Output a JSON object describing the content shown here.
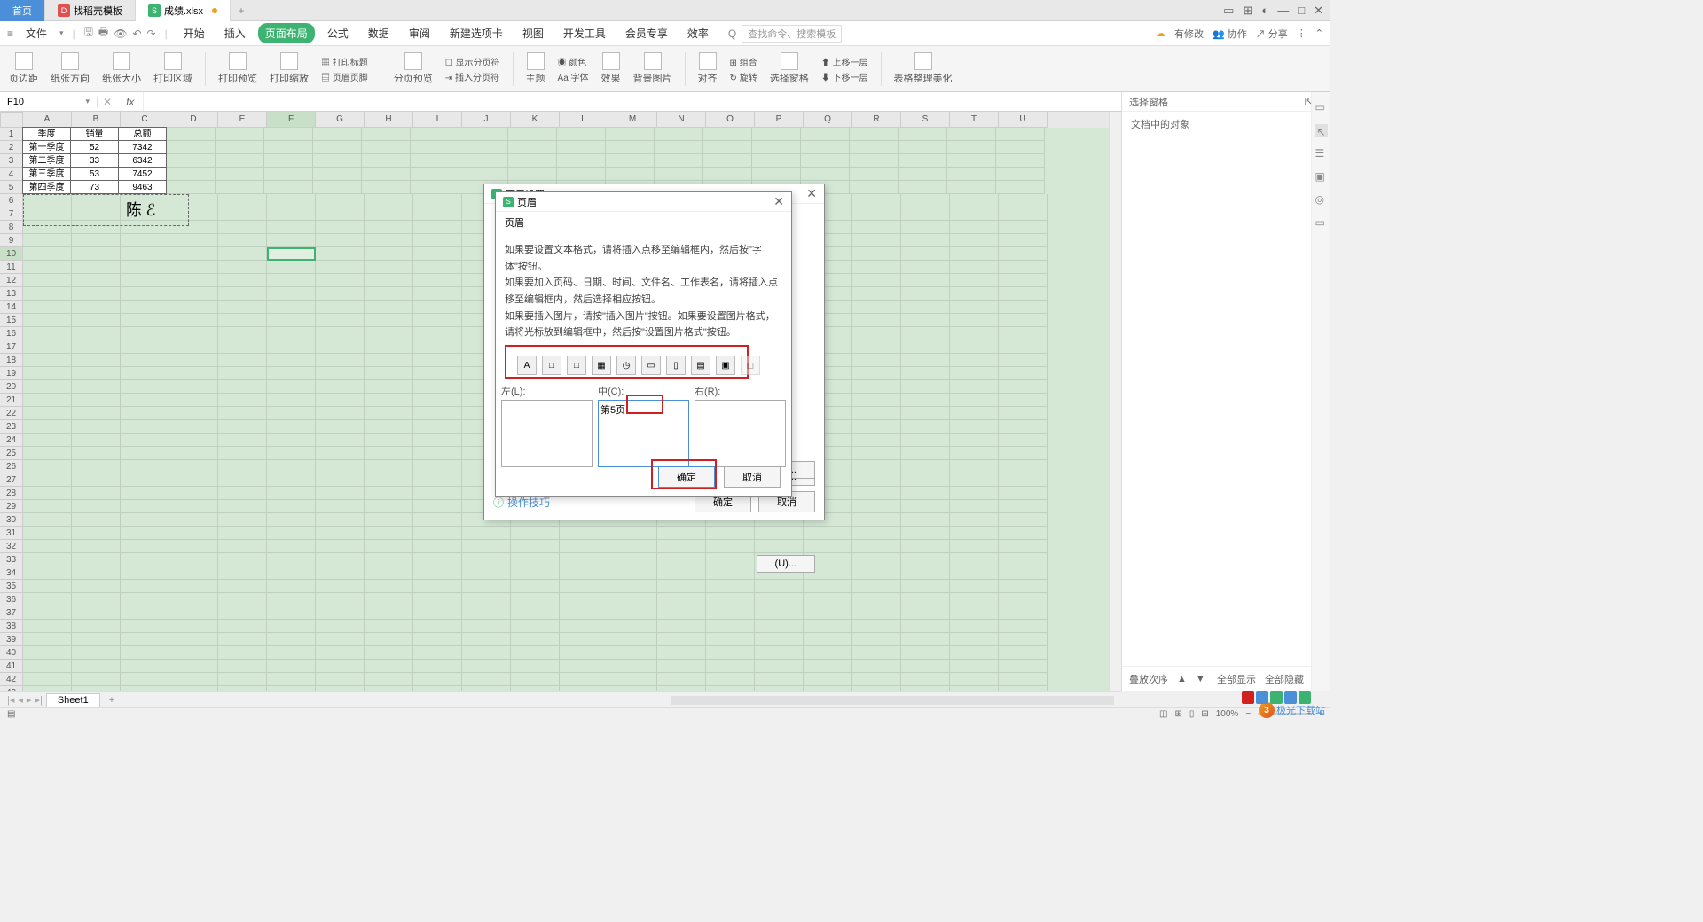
{
  "titlebar": {
    "tabs": [
      {
        "label": "首页",
        "type": "home"
      },
      {
        "label": "找稻壳模板",
        "icon": "D",
        "iconbg": "#e05050"
      },
      {
        "label": "成绩.xlsx",
        "icon": "S",
        "iconbg": "#3cb371",
        "modified": true
      }
    ],
    "add": "+"
  },
  "menubar": {
    "file": "文件",
    "items": [
      "开始",
      "插入",
      "页面布局",
      "公式",
      "数据",
      "审阅",
      "新建选项卡",
      "视图",
      "开发工具",
      "会员专享",
      "效率"
    ],
    "active_index": 2,
    "search_hint": "查找命令、搜索模板",
    "search_prefix": "Q",
    "right": {
      "unsaved": "有修改",
      "collab": "协作",
      "share": "分享"
    }
  },
  "ribbon": {
    "groups": [
      "页边距",
      "纸张方向",
      "纸张大小",
      "打印区域",
      "打印预览",
      "打印缩放",
      "打印标题",
      "页眉页脚",
      "分页预览",
      "显示分页符",
      "插入分页符",
      "主题",
      "颜色",
      "Aa 字体",
      "效果",
      "背景图片",
      "对齐",
      "组合",
      "旋转",
      "选择窗格",
      "上移一层",
      "下移一层",
      "表格整理美化"
    ]
  },
  "formula": {
    "cell_ref": "F10",
    "fx": "fx"
  },
  "grid": {
    "cols": [
      "A",
      "B",
      "C",
      "D",
      "E",
      "F",
      "G",
      "H",
      "I",
      "J",
      "K",
      "L",
      "M",
      "N",
      "O",
      "P",
      "Q",
      "R",
      "S",
      "T",
      "U"
    ],
    "row_count": 43,
    "data": {
      "headers": [
        "季度",
        "销量",
        "总额"
      ],
      "rows": [
        [
          "第一季度",
          "52",
          "7342"
        ],
        [
          "第二季度",
          "33",
          "6342"
        ],
        [
          "第三季度",
          "53",
          "7452"
        ],
        [
          "第四季度",
          "73",
          "9463"
        ]
      ]
    },
    "selected": {
      "col": 5,
      "row": 10,
      "name": "F10"
    },
    "signature": "陈 ℰ"
  },
  "sidepanel": {
    "title": "选择窗格",
    "subtitle": "文档中的对象",
    "order": "叠放次序",
    "show_all": "全部显示",
    "hide_all": "全部隐藏"
  },
  "sheets": {
    "tabs": [
      "Sheet1"
    ],
    "add": "+"
  },
  "status": {
    "zoom": "100%"
  },
  "dialog_back": {
    "title": "页眉设置",
    "tips_link": "操作技巧",
    "ok": "确定",
    "cancel": "取消",
    "btn_c": "(C)...",
    "btn_u": "(U)...",
    "btn_w": "(W)..."
  },
  "dialog_front": {
    "title": "页眉",
    "subtitle": "页眉",
    "help1": "如果要设置文本格式，请将插入点移至编辑框内，然后按\"字体\"按钮。",
    "help2": "如果要加入页码、日期、时间、文件名、工作表名，请将插入点移至编辑框内，然后选择相应按钮。",
    "help3": "如果要插入图片，请按\"插入图片\"按钮。如果要设置图片格式，请将光标放到编辑框中，然后按\"设置图片格式\"按钮。",
    "left_label": "左(L):",
    "center_label": "中(C):",
    "right_label": "右(R):",
    "center_value": "第5页",
    "ok": "确定",
    "cancel": "取消",
    "toolbar_icons": [
      "A",
      "□",
      "□",
      "▦",
      "◷",
      "▭",
      "▯",
      "▤",
      "▣",
      "◻"
    ]
  },
  "watermark": "极光下载站"
}
